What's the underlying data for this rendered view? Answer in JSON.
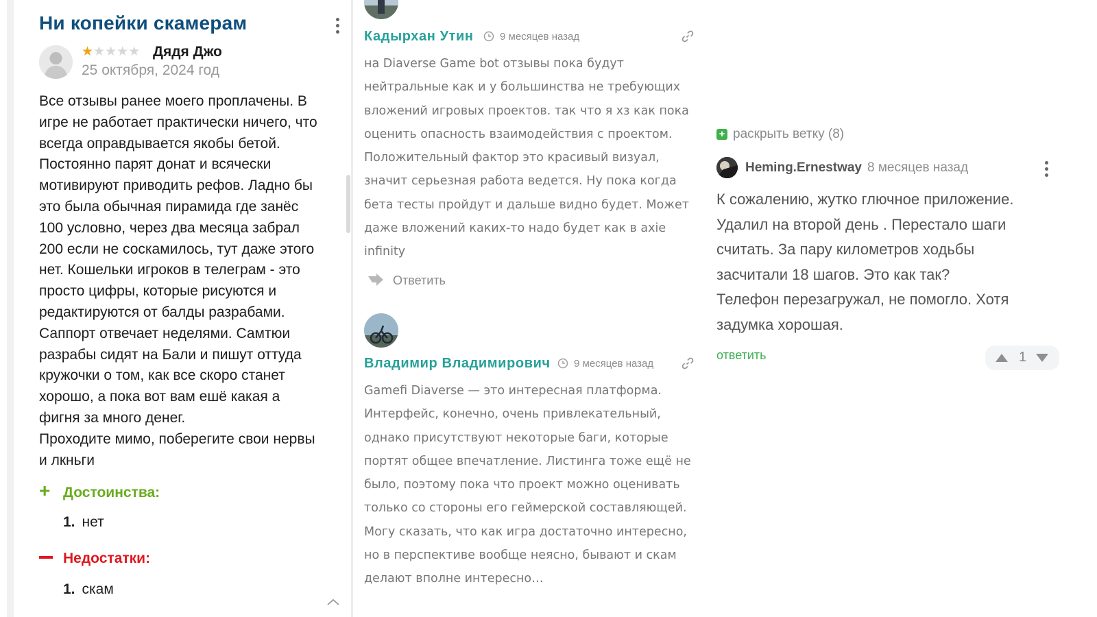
{
  "review": {
    "title": "Ни копейки скамерам",
    "rating": "1 из 5",
    "stars": [
      "★",
      "★",
      "★",
      "★",
      "★"
    ],
    "author": "Дядя Джо",
    "date": "25 октября, 2024 год",
    "body_lines": [
      "Все отзывы ранее моего проплачены. В",
      "игре не работает практически ничего, что",
      "всегда оправдывается якобы бетой.",
      "Постоянно парят донат и всячески",
      "мотивируют приводить рефов. Ладно бы",
      "это была обычная пирамида где занёс",
      "100 условно, через два месяца забрал",
      "200 если не соскамилось, тут даже этого",
      "нет. Кошельки игроков в телеграм - это",
      "просто цифры, которые рисуются и",
      "редактируются от балды разрабами.",
      "Саппорт отвечает неделями. Самтюи",
      "разрабы сидят на Бали и пишут оттуда",
      "кружочки о том, как все скоро станет",
      "хорошо, а пока вот вам ешё какая а",
      "фигня за много денег.",
      "Проходите мимо, поберегите свои нервы",
      "и лкньги"
    ],
    "pros_label": "Достоинства:",
    "pros_sign": "+",
    "pros": [
      {
        "n": "1.",
        "text": "нет"
      }
    ],
    "cons_label": "Недостатки:",
    "cons": [
      {
        "n": "1.",
        "text": "скам"
      }
    ],
    "accent_pros": "#6aab1e",
    "accent_cons": "#e0171f",
    "title_color": "#0f4f7d"
  },
  "comments": [
    {
      "name": "Кадырхан Утин",
      "time": "9 месяцев назад",
      "lines": [
        "на Diaverse Game bot отзывы пока будут",
        "нейтральные как и у большинства не требующих",
        "вложений игровых проектов. так что я хз как пока",
        "оценить опасность взаимодействия с проектом.",
        "Положительный фактор это красивый визуал,",
        "значит серьезная работа ведется. Ну пока когда",
        "бета тесты пройдут и дальше видно будет. Может",
        "даже вложений каких-то надо будет как в axie",
        "infinity"
      ],
      "reply": "Ответить"
    },
    {
      "name": "Владимир Владимирович",
      "time": "9 месяцев назад",
      "lines": [
        "Gamefi Diaverse — это интересная платформа.",
        "Интерфейс, конечно, очень привлекательный,",
        "однако присутствуют некоторые баги, которые",
        "портят общее впечатление. Листинга тоже ещё не",
        "было, поэтому пока что проект можно оценивать",
        "только со стороны его геймерской составляющей.",
        "Могу сказать, что как игра достаточно интересно,",
        "но в перспективе вообще неясно, бывают и скам",
        "делают вполне интересно…"
      ]
    }
  ],
  "thread": {
    "expand_label": "раскрыть ветку (8)",
    "expand_icon": "+",
    "author": "Heming.Ernestway",
    "time": "8 месяцев назад",
    "lines": [
      "К сожалению, жутко глючное приложение.",
      "Удалил на второй день . Перестало шаги",
      "считать. За пару километров ходьбы",
      "засчитали 18 шагов. Это как так?",
      "Телефон перезагружал, не помогло. Хотя",
      "задумка хорошая."
    ],
    "reply": "ответить",
    "votes": "1",
    "accent": "#3fae55"
  }
}
